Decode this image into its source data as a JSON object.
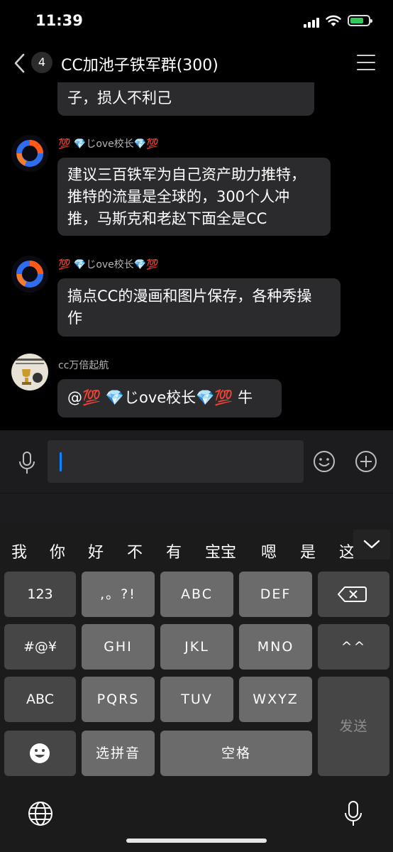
{
  "status_bar": {
    "time": "11:39"
  },
  "header": {
    "unread_count": "4",
    "title": "CC加池子铁军群(300)"
  },
  "chat": {
    "partial_message": "子，损人不利己",
    "messages": [
      {
        "sender": "💯 💎じove校长💎💯",
        "lines": [
          "建议三百铁军为自己资产助力推特，",
          "推特的流量是全球的，300个人冲",
          "推，马斯克和老赵下面全是CC"
        ]
      },
      {
        "sender": "💯 💎じove校长💎💯",
        "lines": [
          "搞点CC的漫画和图片保存，各种秀操",
          "作"
        ]
      },
      {
        "sender": "cc万倍起航",
        "lines": [
          "@💯 💎じove校长💎💯 牛"
        ]
      }
    ]
  },
  "input": {
    "value": ""
  },
  "keyboard": {
    "candidates": [
      "我",
      "你",
      "好",
      "不",
      "有",
      "宝宝",
      "嗯",
      "是",
      "这"
    ],
    "rows": [
      [
        "123",
        ",。?!",
        "ABC",
        "DEF"
      ],
      [
        "#@¥",
        "GHI",
        "JKL",
        "MNO",
        "^^"
      ],
      [
        "ABC",
        "PQRS",
        "TUV",
        "WXYZ"
      ],
      [
        "选拼音",
        "空格"
      ]
    ],
    "send_label": "发送"
  },
  "colors": {
    "accent": "#0a84ff",
    "battery": "#34c759",
    "bubble": "#2b2b2d"
  }
}
